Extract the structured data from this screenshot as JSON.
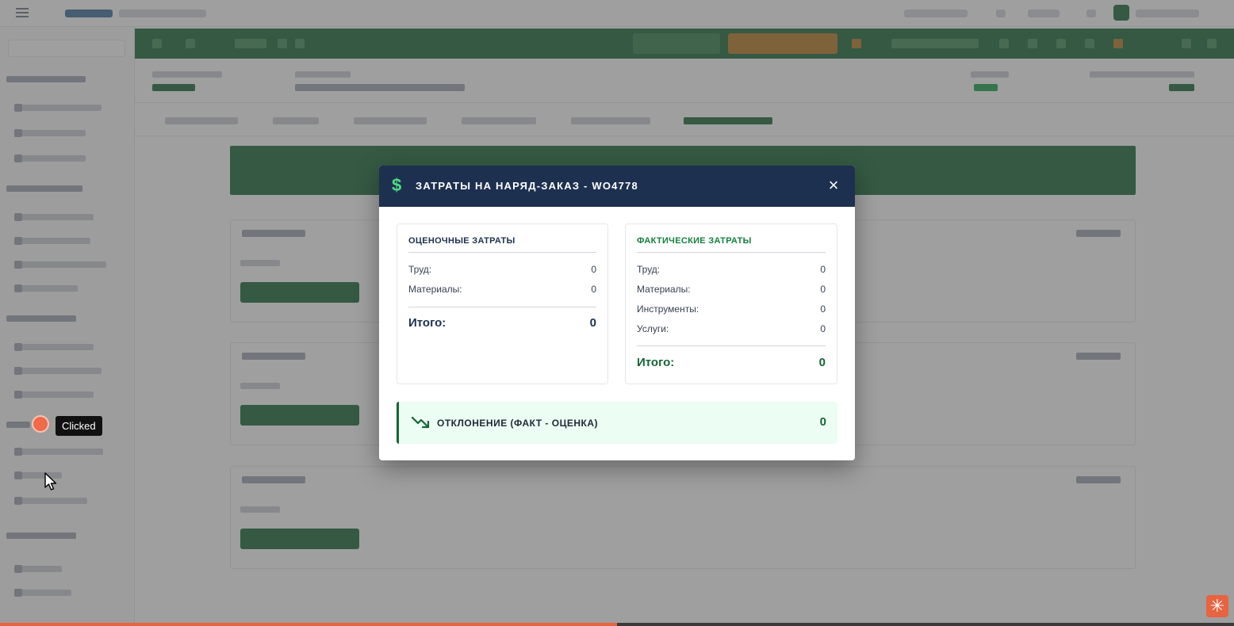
{
  "modal": {
    "title": "ЗАТРАТЫ НА НАРЯД-ЗАКАЗ - WO4778",
    "dollar_icon": "$",
    "close_icon": "×",
    "estimated": {
      "title": "ОЦЕНОЧНЫЕ ЗАТРАТЫ",
      "rows": [
        {
          "label": "Труд:",
          "value": "0"
        },
        {
          "label": "Материалы:",
          "value": "0"
        }
      ],
      "total_label": "Итого:",
      "total_value": "0"
    },
    "actual": {
      "title": "ФАКТИЧЕСКИЕ ЗАТРАТЫ",
      "rows": [
        {
          "label": "Труд:",
          "value": "0"
        },
        {
          "label": "Материалы:",
          "value": "0"
        },
        {
          "label": "Инструменты:",
          "value": "0"
        },
        {
          "label": "Услуги:",
          "value": "0"
        }
      ],
      "total_label": "Итого:",
      "total_value": "0"
    },
    "variance": {
      "label": "ОТКЛОНЕНИЕ (ФАКТ - ОЦЕНКА)",
      "value": "0",
      "icon": "trending-down-icon"
    }
  },
  "click_indicator": {
    "tooltip": "Clicked"
  },
  "progress": {
    "fraction": 0.5
  },
  "colors": {
    "header_navy": "#1e3050",
    "accent_green": "#166534",
    "click_orange": "#ef6b4a"
  }
}
